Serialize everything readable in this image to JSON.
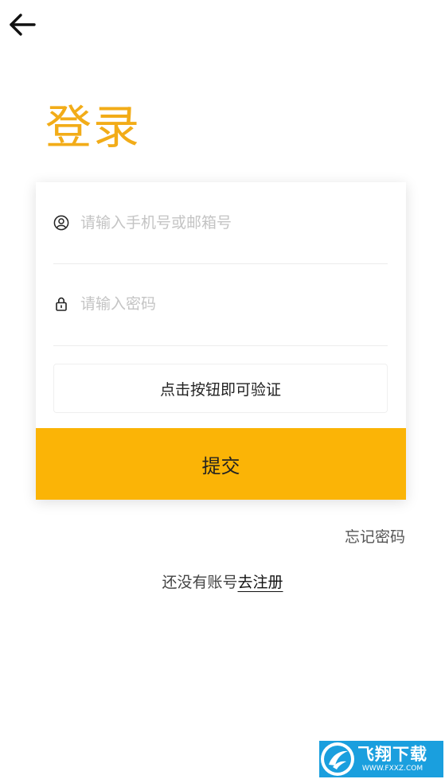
{
  "header": {
    "back_icon": "arrow-left-icon"
  },
  "title": "登录",
  "form": {
    "account": {
      "icon": "user-circle-icon",
      "placeholder": "请输入手机号或邮箱号",
      "value": ""
    },
    "password": {
      "icon": "lock-icon",
      "placeholder": "请输入密码",
      "value": ""
    },
    "verify_label": "点击按钮即可验证",
    "submit_label": "提交"
  },
  "links": {
    "forgot_password": "忘记密码",
    "register_prompt": "还没有账号",
    "register_link": "去注册"
  },
  "watermark": {
    "brand_cn": "飞翔下载",
    "url": "WWW.FXXZ.COM"
  },
  "colors": {
    "accent": "#fbb406",
    "title": "#f2ac18"
  }
}
